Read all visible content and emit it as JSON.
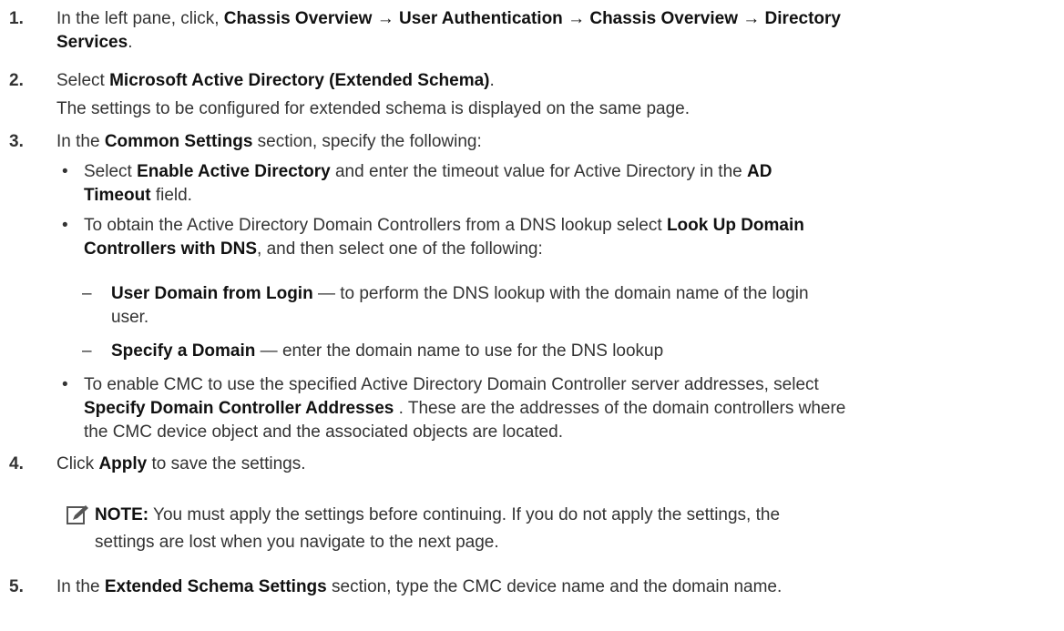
{
  "steps": [
    {
      "num": "1.",
      "parts": [
        {
          "t": "In the left pane, click, "
        },
        {
          "b": "Chassis Overview → User Authentication → Chassis Overview → Directory"
        },
        {
          "br": true
        },
        {
          "b": "Services"
        },
        {
          "t": "."
        }
      ]
    },
    {
      "num": "2.",
      "parts": [
        {
          "t": "Select "
        },
        {
          "b": "Microsoft Active Directory (Extended Schema)"
        },
        {
          "t": "."
        }
      ],
      "sub": "The settings to be configured for extended schema is displayed on the same page."
    },
    {
      "num": "3.",
      "parts": [
        {
          "t": "In the "
        },
        {
          "b": "Common Settings"
        },
        {
          "t": " section, specify the following:"
        }
      ]
    },
    {
      "num": "4.",
      "parts": [
        {
          "t": "Click "
        },
        {
          "b": "Apply"
        },
        {
          "t": " to save the settings."
        }
      ]
    },
    {
      "num": "5.",
      "parts": [
        {
          "t": "In the "
        },
        {
          "b": "Extended Schema Settings"
        },
        {
          "t": " section, type the CMC device name and the domain name."
        }
      ]
    }
  ],
  "bullets": [
    {
      "mark": "•",
      "parts": [
        {
          "t": "Select "
        },
        {
          "b": "Enable Active Directory"
        },
        {
          "t": " and enter the timeout value for Active Directory in the "
        },
        {
          "b": "AD"
        },
        {
          "br": true
        },
        {
          "b": "Timeout"
        },
        {
          "t": " field."
        }
      ]
    },
    {
      "mark": "•",
      "parts": [
        {
          "t": "To obtain the Active Directory Domain Controllers from a DNS lookup select "
        },
        {
          "b": "Look Up Domain"
        },
        {
          "br": true
        },
        {
          "b": "Controllers with DNS"
        },
        {
          "t": ", and then select one of the following:"
        }
      ]
    },
    {
      "mark": "•",
      "parts": [
        {
          "t": "To enable CMC to use the specified Active Directory Domain Controller server addresses, select"
        },
        {
          "br": true
        },
        {
          "b": "Specify Domain Controller Addresses"
        },
        {
          "t": " . These are the addresses of the domain controllers where"
        },
        {
          "br": true
        },
        {
          "t": "the CMC device object and the associated objects are located."
        }
      ]
    }
  ],
  "dashes": [
    {
      "mark": "–",
      "parts": [
        {
          "b": "User Domain from Login"
        },
        {
          "t": " — to perform the DNS lookup with the domain name of the login"
        },
        {
          "br": true
        },
        {
          "t": "user."
        }
      ]
    },
    {
      "mark": "–",
      "parts": [
        {
          "b": "Specify a Domain"
        },
        {
          "t": " — enter the domain name to use for the DNS lookup"
        }
      ]
    }
  ],
  "note": {
    "icon": "pencil-note-icon",
    "label": "NOTE:",
    "text_line1": " You must apply the settings before continuing. If you do not apply the settings, the",
    "text_line2": "settings are lost when you navigate to the next page."
  }
}
